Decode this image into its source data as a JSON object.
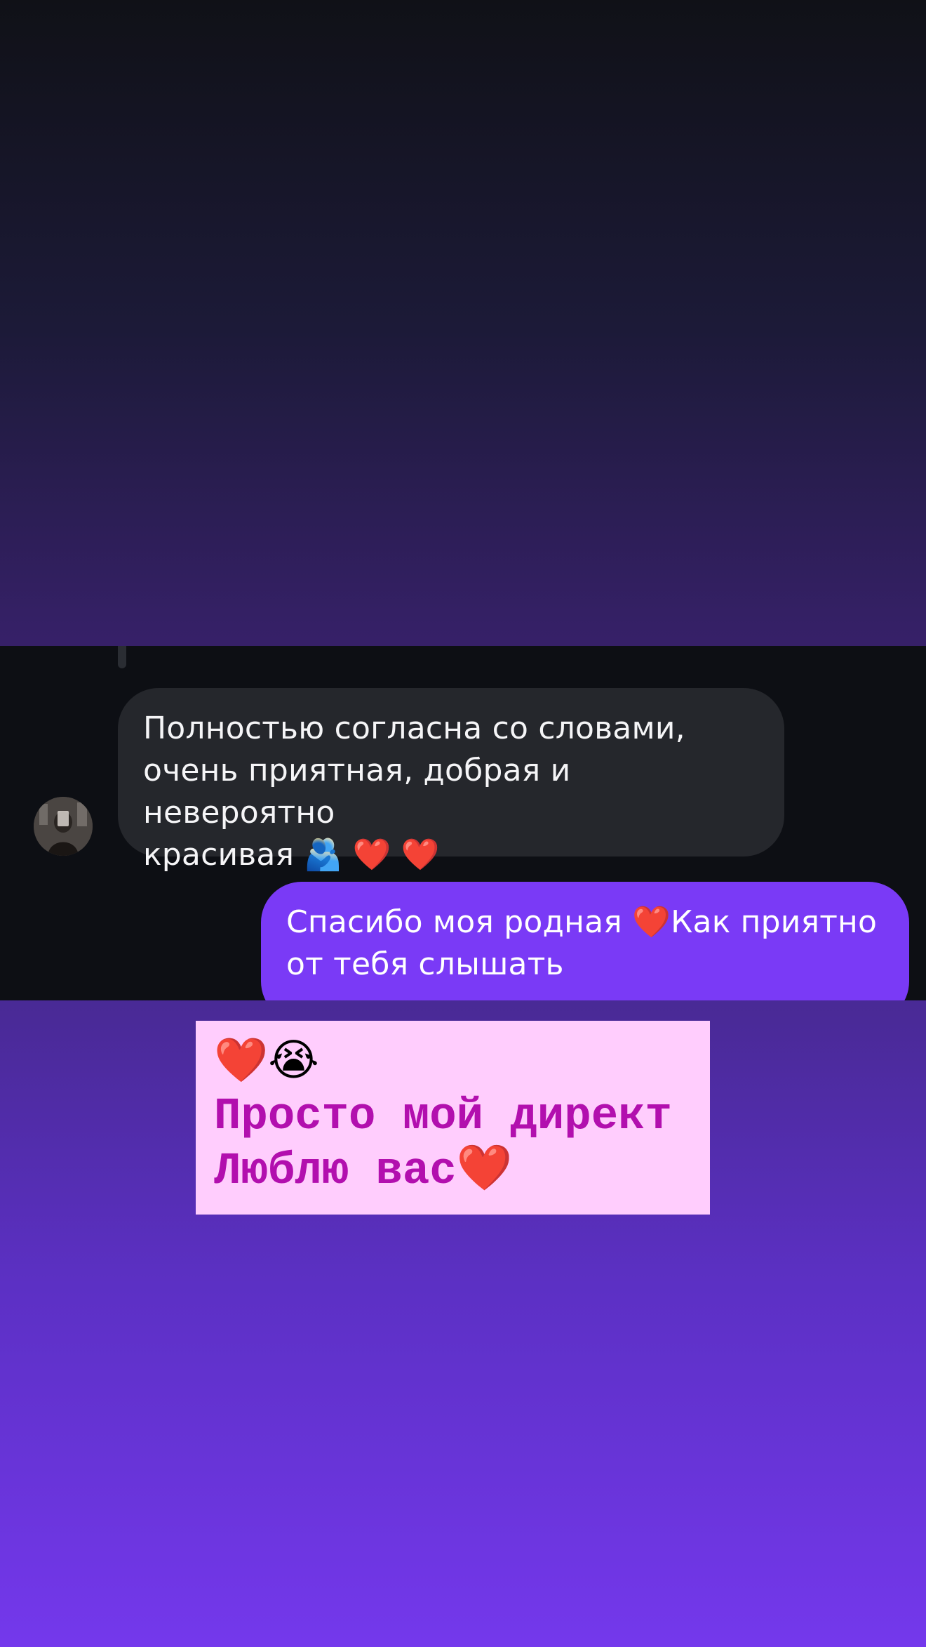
{
  "messages": {
    "incoming": {
      "text": "Полностью согласна со словами,\nочень приятная, добрая и невероятно\nкрасивая 🫂 ❤️ ❤️"
    },
    "outgoing": {
      "text": "Спасибо моя родная ❤️Как приятно\nот тебя слышать"
    }
  },
  "caption": {
    "emojis": "❤️😭",
    "text": "Просто мой директ\nЛюблю вас❤️"
  },
  "colors": {
    "incoming_bubble": "#25272c",
    "outgoing_bubble": "#7a3af6",
    "caption_background": "#ffcdfd",
    "caption_text": "#b20fae"
  }
}
